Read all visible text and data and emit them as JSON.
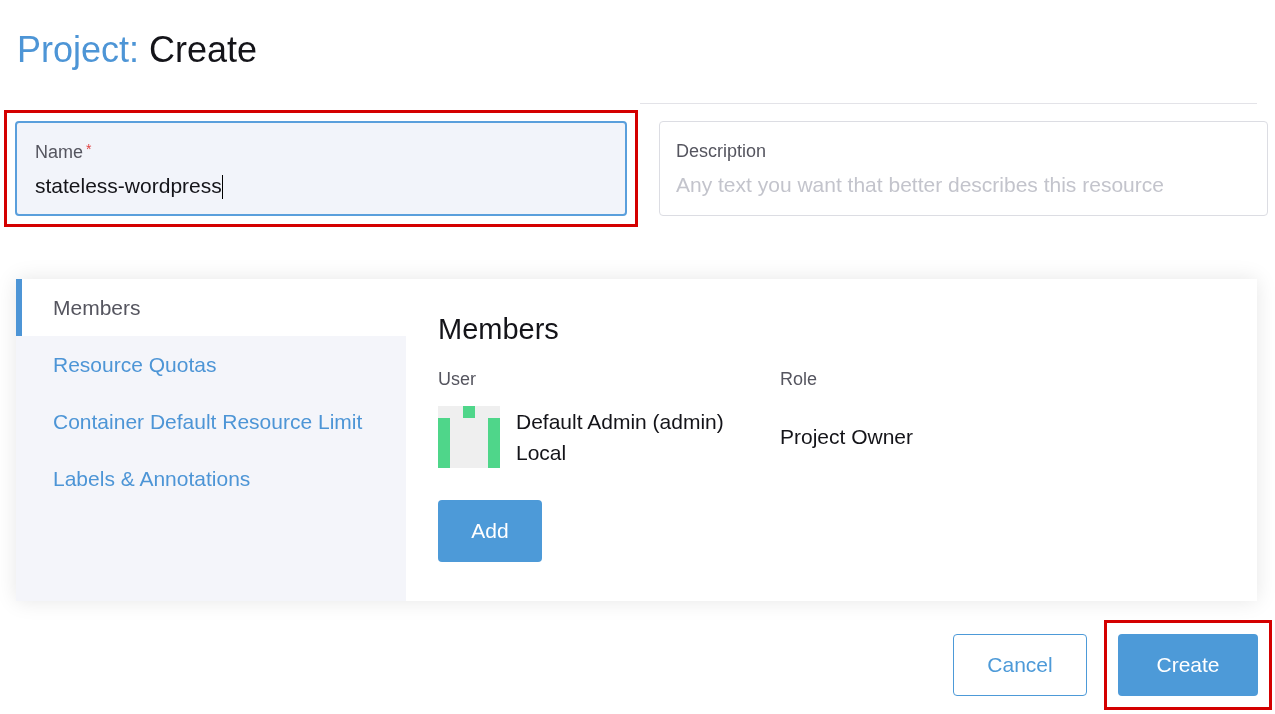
{
  "header": {
    "prefix": "Project:",
    "title": "Create"
  },
  "name_field": {
    "label": "Name",
    "required_mark": "*",
    "value": "stateless-wordpress",
    "focused": true,
    "highlighted": true
  },
  "description_field": {
    "label": "Description",
    "placeholder": "Any text you want that better describes this resource"
  },
  "sidebar": {
    "items": [
      {
        "label": "Members",
        "selected": true
      },
      {
        "label": "Resource Quotas",
        "selected": false
      },
      {
        "label": "Container Default Resource Limit",
        "selected": false
      },
      {
        "label": "Labels & Annotations",
        "selected": false
      }
    ]
  },
  "members": {
    "title": "Members",
    "columns": [
      "User",
      "Role"
    ],
    "rows": [
      {
        "user": "Default Admin (admin)",
        "source": "Local",
        "role": "Project Owner"
      }
    ],
    "add_button": "Add"
  },
  "actions": [
    {
      "label": "Cancel",
      "kind": "secondary",
      "highlighted": false
    },
    {
      "label": "Create",
      "kind": "primary",
      "highlighted": true
    }
  ]
}
